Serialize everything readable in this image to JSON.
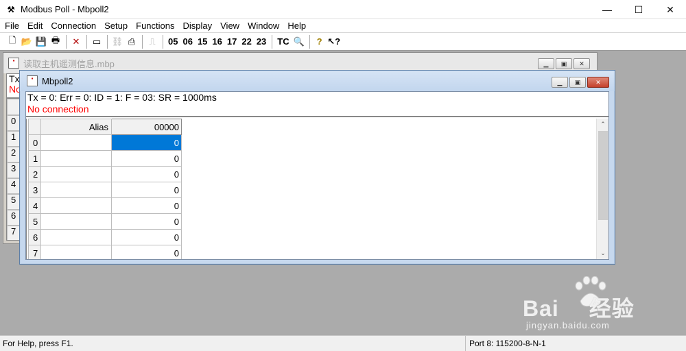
{
  "window": {
    "title": "Modbus Poll - Mbpoll2",
    "controls": {
      "minimize": "—",
      "maximize": "☐",
      "close": "✕"
    }
  },
  "menu": {
    "items": [
      "File",
      "Edit",
      "Connection",
      "Setup",
      "Functions",
      "Display",
      "View",
      "Window",
      "Help"
    ]
  },
  "toolbar": {
    "function_codes": [
      "05",
      "06",
      "15",
      "16",
      "17",
      "22",
      "23"
    ],
    "tc_label": "TC"
  },
  "back_window": {
    "title": "读取主机遥测信息.mbp",
    "status_line1": "Tx",
    "status_line2": "No",
    "row_numbers": [
      "0",
      "1",
      "2",
      "3",
      "4",
      "5",
      "6",
      "7"
    ]
  },
  "front_window": {
    "title": "Mbpoll2",
    "status_line": "Tx = 0: Err = 0: ID = 1: F = 03: SR = 1000ms",
    "error_line": "No connection",
    "columns": {
      "alias": "Alias",
      "register": "00000"
    },
    "rows": [
      {
        "num": "0",
        "value": "0"
      },
      {
        "num": "1",
        "value": "0"
      },
      {
        "num": "2",
        "value": "0"
      },
      {
        "num": "3",
        "value": "0"
      },
      {
        "num": "4",
        "value": "0"
      },
      {
        "num": "5",
        "value": "0"
      },
      {
        "num": "6",
        "value": "0"
      },
      {
        "num": "7",
        "value": "0"
      }
    ]
  },
  "watermark": {
    "brand_left": "Bai",
    "brand_right": "经验",
    "url": "jingyan.baidu.com"
  },
  "statusbar": {
    "help": "For Help, press F1.",
    "port": "Port 8: 115200-8-N-1"
  },
  "colors": {
    "selection": "#0078d7",
    "error_text": "#ff0000",
    "mdi_background": "#ababab"
  }
}
